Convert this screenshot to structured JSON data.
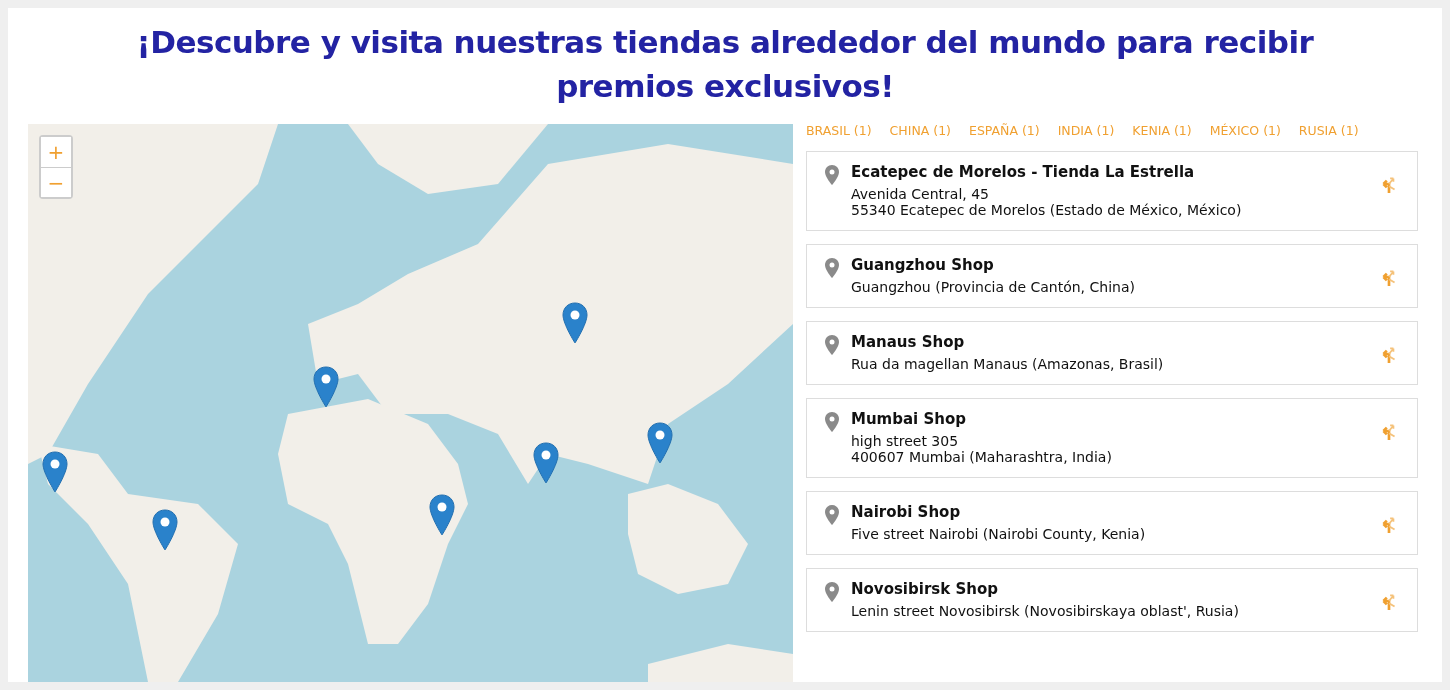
{
  "title": "¡Descubre y visita nuestras tiendas alrededor del mundo para recibir premios exclusivos!",
  "map": {
    "zoom_in": "+",
    "zoom_out": "−"
  },
  "filters": [
    {
      "label": "BRASIL (1)"
    },
    {
      "label": "CHINA (1)"
    },
    {
      "label": "ESPAÑA (1)"
    },
    {
      "label": "INDIA (1)"
    },
    {
      "label": "KENIA (1)"
    },
    {
      "label": "MÉXICO (1)"
    },
    {
      "label": "RUSIA (1)"
    }
  ],
  "stores": [
    {
      "name": "Ecatepec de Morelos - Tienda La Estrella",
      "address": [
        "Avenida Central, 45",
        "55340 Ecatepec de Morelos (Estado de México, México)"
      ]
    },
    {
      "name": "Guangzhou Shop",
      "address": [
        "Guangzhou (Provincia de Cantón, China)"
      ]
    },
    {
      "name": "Manaus Shop",
      "address": [
        "Rua da magellan Manaus (Amazonas, Brasil)"
      ]
    },
    {
      "name": "Mumbai Shop",
      "address": [
        "high street 305",
        "400607 Mumbai (Maharashtra, India)"
      ]
    },
    {
      "name": "Nairobi Shop",
      "address": [
        "Five street Nairobi (Nairobi County, Kenia)"
      ]
    },
    {
      "name": "Novosibirsk Shop",
      "address": [
        "Lenin street Novosibirsk (Novosibirskaya oblast', Rusia)"
      ]
    }
  ]
}
